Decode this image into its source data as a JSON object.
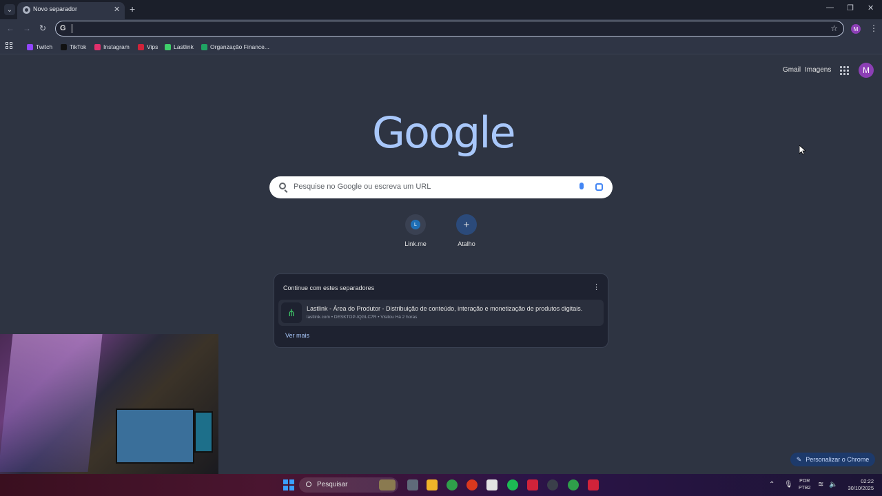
{
  "browser": {
    "tab_title": "Novo separador",
    "omnibox_value": "",
    "profile_initial": "M",
    "bookmarks": [
      {
        "label": "Twitch",
        "color": "#9146ff"
      },
      {
        "label": "TikTok",
        "color": "#111111"
      },
      {
        "label": "Instagram",
        "color": "#e1306c"
      },
      {
        "label": "Vips",
        "color": "#d0233a"
      },
      {
        "label": "Lastlink",
        "color": "#3fcf6a"
      },
      {
        "label": "Organzação Finance...",
        "color": "#1fa463"
      }
    ]
  },
  "page": {
    "header_links": {
      "gmail": "Gmail",
      "images": "Imagens"
    },
    "avatar_initial": "M",
    "logo": "Google",
    "search_placeholder": "Pesquise no Google ou escreva um URL",
    "shortcuts": [
      {
        "label": "Link.me",
        "initial": "L"
      },
      {
        "label": "Atalho",
        "initial": "+"
      }
    ],
    "continue_card": {
      "title": "Continue com estes separadores",
      "item_title": "Lastlink - Área do Produtor - Distribuição de conteúdo, interação e monetização de produtos digitais.",
      "item_subtitle": "lastlink.com • DESKTOP-IQGLC7R • Visitou Há 2 horas",
      "more": "Ver mais"
    },
    "customize_button": "Personalizar o Chrome"
  },
  "taskbar": {
    "search_label": "Pesquisar",
    "lang_line1": "POR",
    "lang_line2": "PTB2",
    "time": "02:22",
    "date": "30/10/2025"
  }
}
